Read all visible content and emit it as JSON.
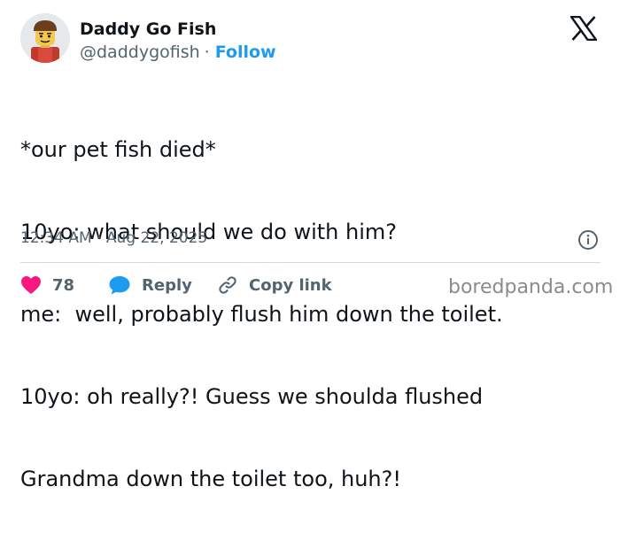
{
  "user": {
    "name": "Daddy Go Fish",
    "handle": "@daddygofish",
    "separator": "·",
    "follow_label": "Follow",
    "avatar_icon": "lego-minifigure-avatar"
  },
  "platform_icon": "x-logo-icon",
  "tweet": {
    "lines": [
      "*our pet fish died*",
      "10yo: what should we do with him?",
      "me:  well, probably flush him down the toilet.",
      "10yo: oh really?! Guess we shoulda flushed",
      "Grandma down the toilet too, huh?!"
    ],
    "timestamp": "12:34 AM · Aug 22, 2025"
  },
  "actions": {
    "like_count": "78",
    "reply_label": "Reply",
    "copy_label": "Copy link"
  },
  "watermark": "boredpanda.com",
  "colors": {
    "accent": "#1d9bf0",
    "like": "#f91880",
    "text": "#0f1419",
    "muted": "#536471",
    "divider": "#cfd9de"
  }
}
